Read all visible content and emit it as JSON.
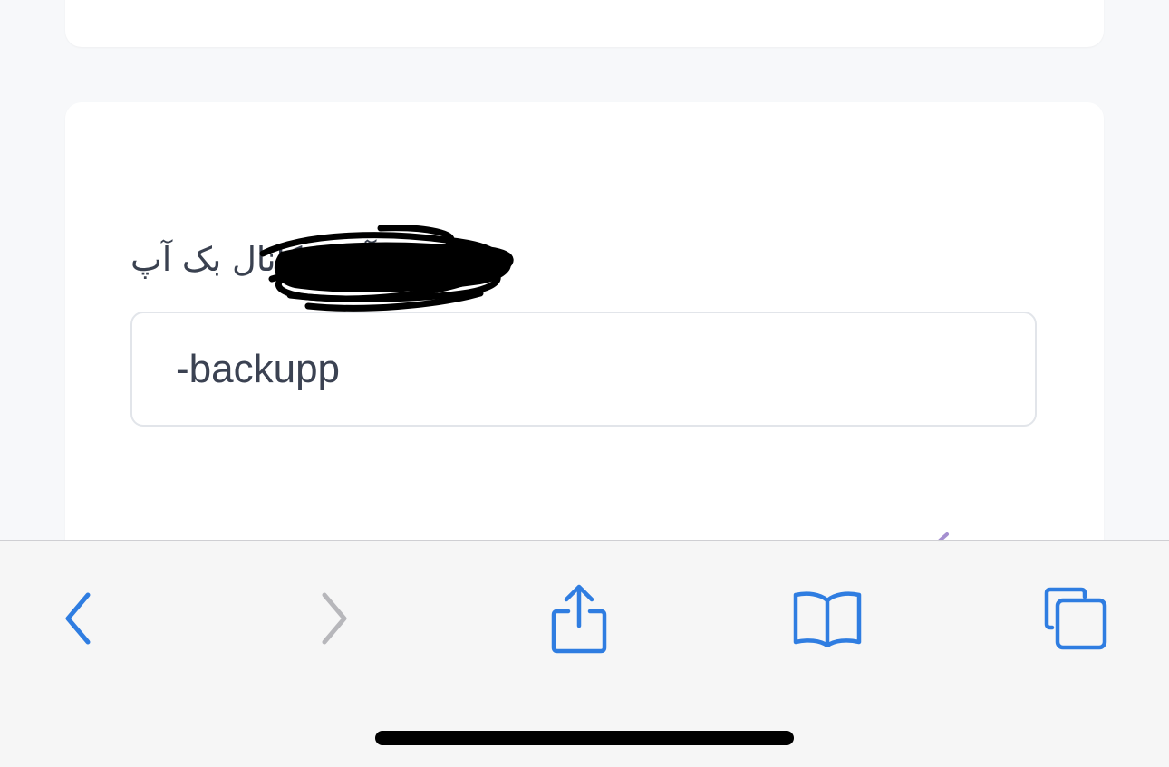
{
  "form": {
    "backup_channel_label": "آیدی کانال بک آپ",
    "backup_channel_value": "-backupp"
  },
  "toolbar": {
    "back_icon": "chevron-left",
    "forward_icon": "chevron-right",
    "share_icon": "share",
    "bookmarks_icon": "book",
    "tabs_icon": "tabs"
  },
  "colors": {
    "page_background": "#f7f8fa",
    "card": "#ffffff",
    "accent": "#2f7de1",
    "disabled": "#b7b7bb",
    "label_text": "#3a4150",
    "input_border": "#e2e5ea"
  }
}
